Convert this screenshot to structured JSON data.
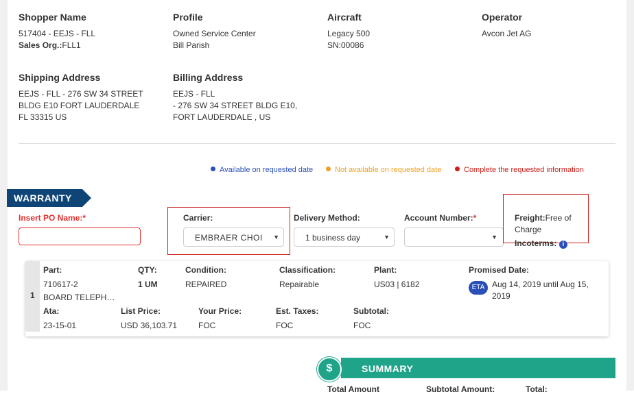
{
  "shopper": {
    "heading": "Shopper Name",
    "line1": "517404 - EEJS - FLL",
    "org_label": "Sales Org.:",
    "org_value": "FLL1"
  },
  "profile": {
    "heading": "Profile",
    "line1": "Owned Service Center",
    "line2": "Bill Parish"
  },
  "aircraft": {
    "heading": "Aircraft",
    "line1": "Legacy 500",
    "line2": "SN:00086"
  },
  "operator": {
    "heading": "Operator",
    "line1": "Avcon Jet AG"
  },
  "shipping": {
    "heading": "Shipping Address",
    "line1": "EEJS - FLL - 276 SW 34 STREET",
    "line2": "BLDG E10 FORT LAUDERDALE",
    "line3": "FL 33315 US"
  },
  "billing": {
    "heading": "Billing Address",
    "line1": "EEJS - FLL",
    "line2": "- 276 SW 34 STREET BLDG E10,",
    "line3": "FORT LAUDERDALE , US"
  },
  "legend": {
    "available": {
      "label": "Available on requested date",
      "color": "#2b4fb8"
    },
    "not_available": {
      "label": "Not available on requested date",
      "color": "#f0a020"
    },
    "complete": {
      "label": "Complete the requested information",
      "color": "#c9201a"
    }
  },
  "section_title": "WARRANTY",
  "form": {
    "po_label": "Insert PO Name:",
    "po_required": "*",
    "po_value": "",
    "carrier_label": "Carrier:",
    "carrier_value": "EMBRAER CHOI",
    "delivery_label": "Delivery Method:",
    "delivery_value": "1 business day",
    "account_label": "Account Number:",
    "account_required": "*",
    "account_value": "",
    "freight_label": "Freight:",
    "freight_value": "Free of Charge",
    "incoterms_label": "Incoterms:"
  },
  "item": {
    "index": "1",
    "part_label": "Part:",
    "part_number": "710617-2",
    "part_desc": "BOARD TELEPH…",
    "qty_label": "QTY:",
    "qty_value": "1 UM",
    "condition_label": "Condition:",
    "condition_value": "REPAIRED",
    "classification_label": "Classification:",
    "classification_value": "Repairable",
    "plant_label": "Plant:",
    "plant_value": "US03 | 6182",
    "promised_label": "Promised Date:",
    "eta_badge": "ETA",
    "promised_line1": "Aug 14, 2019 until Aug 15,",
    "promised_line2": "2019",
    "ata_label": "Ata:",
    "ata_value": "23-15-01",
    "list_label": "List Price:",
    "list_value": "USD 36,103.71",
    "your_label": "Your Price:",
    "your_value": "FOC",
    "tax_label": "Est. Taxes:",
    "tax_value": "FOC",
    "subtotal_label": "Subtotal:",
    "subtotal_value": "FOC"
  },
  "summary": {
    "icon": "dollar-icon",
    "title": "SUMMARY",
    "col1": "Total Amount",
    "col2": "Subtotal Amount:",
    "col3": "Total:"
  }
}
